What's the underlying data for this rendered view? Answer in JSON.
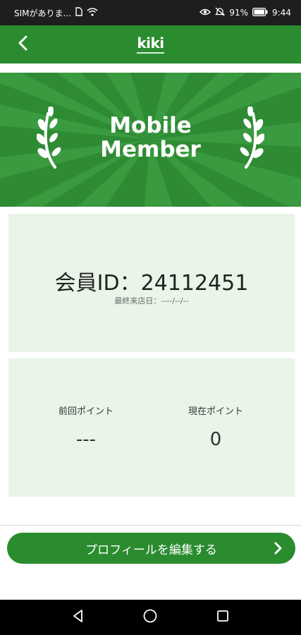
{
  "status_bar": {
    "carrier": "SIMがありま...",
    "battery": "91%",
    "time": "9:44"
  },
  "app_bar": {
    "logo_text": "kiki"
  },
  "banner": {
    "line1": "Mobile",
    "line2": "Member"
  },
  "member_card": {
    "member_id": "会員ID：24112451",
    "last_visit": "最終来店日：----/--/--"
  },
  "points_card": {
    "previous_label": "前回ポイント",
    "previous_value": "---",
    "current_label": "現在ポイント",
    "current_value": "0"
  },
  "edit_profile": {
    "label": "プロフィールを編集する"
  },
  "colors": {
    "primary_green": "#2a8c2f",
    "card_bg": "#e8f5e8",
    "status_bar": "#1e1e1e",
    "nav_bar": "#000000"
  },
  "icons": [
    "back-arrow-icon",
    "laurel-icon",
    "chevron-right-icon",
    "nav-back-icon",
    "nav-home-icon",
    "nav-recents-icon"
  ]
}
